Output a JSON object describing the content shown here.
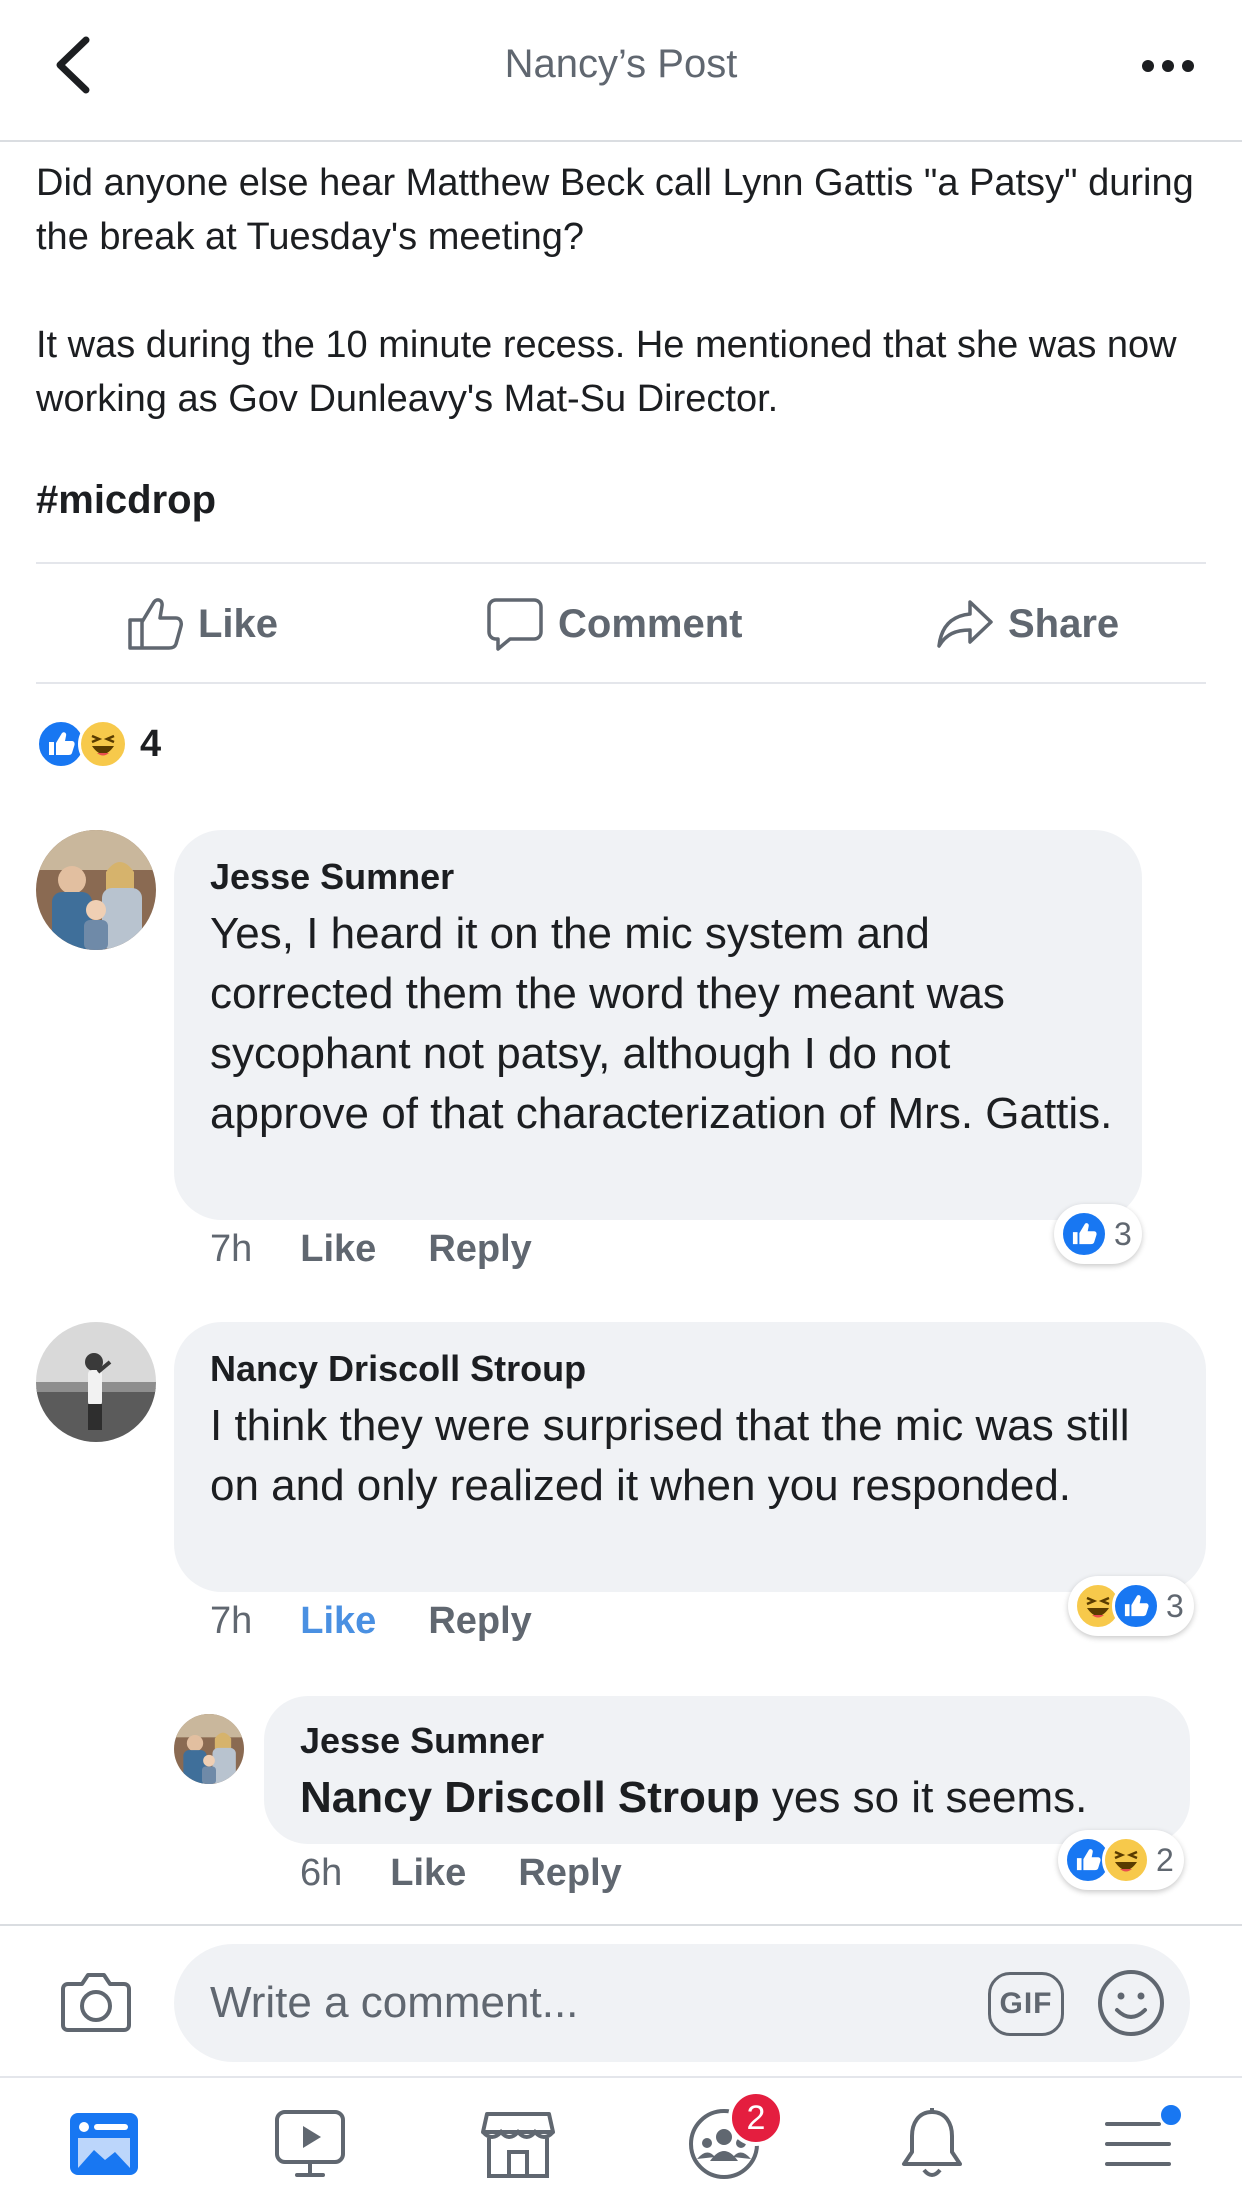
{
  "header": {
    "title": "Nancy’s Post",
    "back_icon": "chevron-left-icon",
    "more_icon": "more-horizontal-icon"
  },
  "post": {
    "paragraph1": "Did anyone else hear Matthew Beck call Lynn Gattis \"a Patsy\" during the break at Tuesday's meeting?",
    "paragraph2": "It was during the 10 minute recess.  He mentioned that she was now working as Gov Dunleavy's Mat-Su Director.",
    "hashtag": "#micdrop"
  },
  "actions": {
    "like": "Like",
    "comment": "Comment",
    "share": "Share"
  },
  "reactions": {
    "types": [
      "like",
      "haha"
    ],
    "count": "4"
  },
  "comments": [
    {
      "author": "Jesse Sumner",
      "text": "Yes, I heard it on the mic system and corrected them the word they meant was sycophant not patsy, although I do not approve of that characterization of Mrs. Gattis.",
      "time": "7h",
      "like_label": "Like",
      "reply_label": "Reply",
      "liked": false,
      "reactions": [
        "like"
      ],
      "reaction_count": "3"
    },
    {
      "author": "Nancy Driscoll Stroup",
      "text": "I think they were surprised that the mic  was still on and only realized it when you responded.",
      "time": "7h",
      "like_label": "Like",
      "reply_label": "Reply",
      "liked": true,
      "reactions": [
        "haha",
        "like"
      ],
      "reaction_count": "3"
    }
  ],
  "reply": {
    "author": "Jesse Sumner",
    "mention": "Nancy Driscoll Stroup",
    "text": " yes so it seems.",
    "time": "6h",
    "like_label": "Like",
    "reply_label": "Reply",
    "reactions": [
      "like",
      "haha"
    ],
    "reaction_count": "2"
  },
  "composer": {
    "placeholder": "Write a comment...",
    "gif_label": "GIF",
    "camera_icon": "camera-icon",
    "emoji_icon": "emoji-icon"
  },
  "tabbar": {
    "tabs": [
      "news-feed-icon",
      "watch-icon",
      "marketplace-icon",
      "groups-icon",
      "notifications-icon",
      "menu-icon"
    ],
    "groups_badge": "2"
  },
  "colors": {
    "brand_blue": "#1877f2",
    "liked_blue": "#4a90e2",
    "bubble_gray": "#f0f2f5",
    "secondary_text": "#606770",
    "badge_red": "#e41e3f",
    "haha_yellow": "#f7c94b"
  }
}
